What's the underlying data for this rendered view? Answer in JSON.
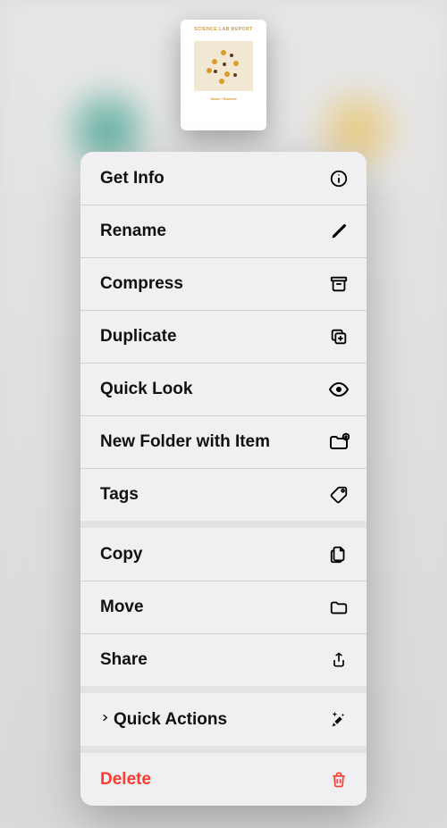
{
  "file_preview": {
    "title": "SCIENCE LAB REPORT",
    "caption": "Name / Student"
  },
  "menu": {
    "groups": [
      {
        "items": [
          {
            "label": "Get Info",
            "icon": "info-icon"
          },
          {
            "label": "Rename",
            "icon": "pencil-icon"
          },
          {
            "label": "Compress",
            "icon": "archivebox-icon"
          },
          {
            "label": "Duplicate",
            "icon": "duplicate-icon"
          },
          {
            "label": "Quick Look",
            "icon": "eye-icon"
          },
          {
            "label": "New Folder with Item",
            "icon": "folder-plus-icon"
          },
          {
            "label": "Tags",
            "icon": "tag-icon"
          }
        ]
      },
      {
        "items": [
          {
            "label": "Copy",
            "icon": "doc-on-doc-icon"
          },
          {
            "label": "Move",
            "icon": "folder-icon"
          },
          {
            "label": "Share",
            "icon": "share-icon"
          }
        ]
      },
      {
        "items": [
          {
            "label": "Quick Actions",
            "icon": "sparkles-icon",
            "has_chevron": true
          }
        ]
      },
      {
        "items": [
          {
            "label": "Delete",
            "icon": "trash-icon",
            "destructive": true
          }
        ]
      }
    ]
  }
}
